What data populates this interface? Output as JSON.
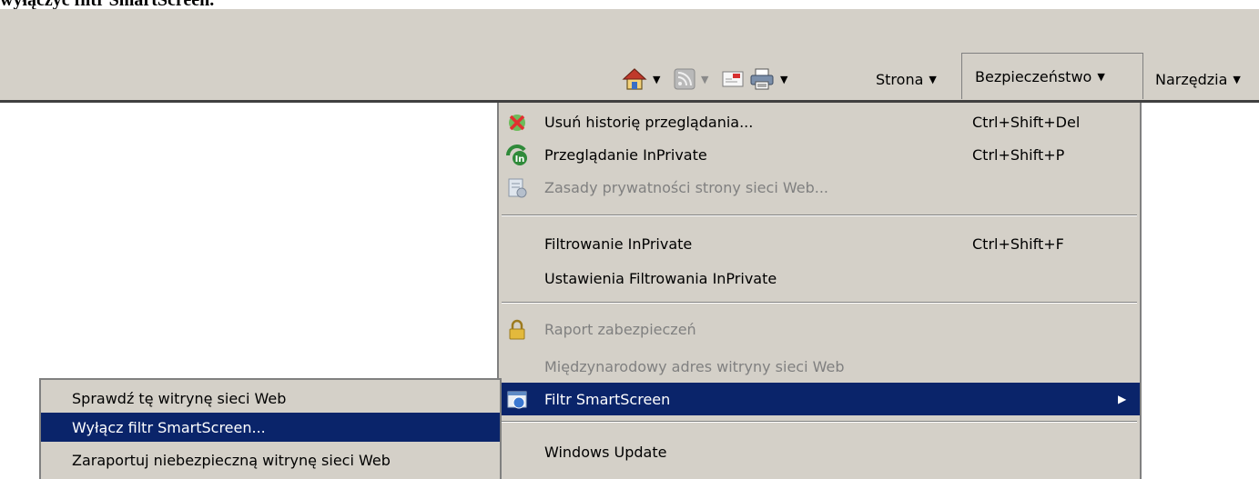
{
  "caption": "wyłączyć filtr SmartScreen.",
  "toolbar": {
    "home_icon": "home-icon",
    "feeds_icon": "rss-feed-icon",
    "mail_icon": "mail-icon",
    "print_icon": "print-icon",
    "strona_label": "Strona",
    "bezpieczenstwo_label": "Bezpieczeństwo",
    "narzedzia_label": "Narzędzia"
  },
  "menu": {
    "items": [
      {
        "label": "Usuń historię przeglądania...",
        "shortcut": "Ctrl+Shift+Del",
        "icon": "delete-history-icon",
        "enabled": true
      },
      {
        "label": "Przeglądanie InPrivate",
        "shortcut": "Ctrl+Shift+P",
        "icon": "inprivate-icon",
        "enabled": true
      },
      {
        "label": "Zasady prywatności strony sieci Web...",
        "shortcut": "",
        "icon": "privacy-policy-icon",
        "enabled": false
      },
      {
        "label": "Filtrowanie InPrivate",
        "shortcut": "Ctrl+Shift+F",
        "icon": "",
        "enabled": true
      },
      {
        "label": "Ustawienia Filtrowania InPrivate",
        "shortcut": "",
        "icon": "",
        "enabled": true
      },
      {
        "label": "Raport zabezpieczeń",
        "shortcut": "",
        "icon": "lock-icon",
        "enabled": false
      },
      {
        "label": "Międzynarodowy adres witryny sieci Web",
        "shortcut": "",
        "icon": "",
        "enabled": false
      },
      {
        "label": "Filtr SmartScreen",
        "shortcut": "",
        "icon": "smartscreen-icon",
        "enabled": true,
        "highlighted": true
      },
      {
        "label": "Windows Update",
        "shortcut": "",
        "icon": "",
        "enabled": true
      }
    ]
  },
  "submenu": {
    "items": [
      {
        "label": "Sprawdź tę witrynę sieci Web"
      },
      {
        "label": "Wyłącz filtr SmartScreen...",
        "highlighted": true
      },
      {
        "label": "Zaraportuj niebezpieczną witrynę sieci Web"
      }
    ]
  },
  "colors": {
    "menu_bg": "#d4d0c8",
    "highlight": "#0a246a",
    "disabled_text": "#808080"
  }
}
